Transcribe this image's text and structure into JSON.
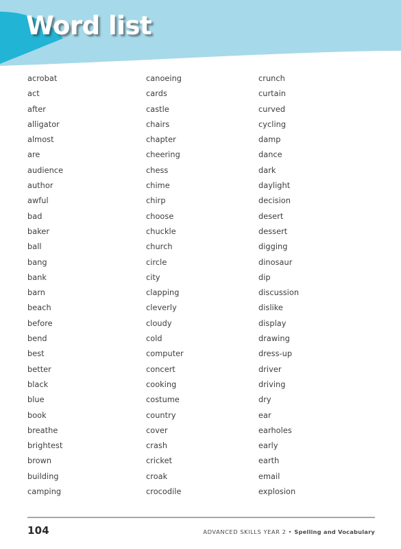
{
  "header": {
    "title": "Word list",
    "band_color": "#a6d9ea",
    "accent_color": "#22b4d4",
    "title_color": "#ffffff"
  },
  "word_list": {
    "columns": [
      {
        "name": "column-1",
        "words": [
          "acrobat",
          "act",
          "after",
          "alligator",
          "almost",
          "are",
          "audience",
          "author",
          "awful",
          "bad",
          "baker",
          "ball",
          "bang",
          "bank",
          "barn",
          "beach",
          "before",
          "bend",
          "best",
          "better",
          "black",
          "blue",
          "book",
          "breathe",
          "brightest",
          "brown",
          "building",
          "camping"
        ]
      },
      {
        "name": "column-2",
        "words": [
          "canoeing",
          "cards",
          "castle",
          "chairs",
          "chapter",
          "cheering",
          "chess",
          "chime",
          "chirp",
          "choose",
          "chuckle",
          "church",
          "circle",
          "city",
          "clapping",
          "cleverly",
          "cloudy",
          "cold",
          "computer",
          "concert",
          "cooking",
          "costume",
          "country",
          "cover",
          "crash",
          "cricket",
          "croak",
          "crocodile"
        ]
      },
      {
        "name": "column-3",
        "words": [
          "crunch",
          "curtain",
          "curved",
          "cycling",
          "damp",
          "dance",
          "dark",
          "daylight",
          "decision",
          "desert",
          "dessert",
          "digging",
          "dinosaur",
          "dip",
          "discussion",
          "dislike",
          "display",
          "drawing",
          "dress-up",
          "driver",
          "driving",
          "dry",
          "ear",
          "earholes",
          "early",
          "earth",
          "email",
          "explosion"
        ]
      }
    ]
  },
  "footer": {
    "page_number": "104",
    "source_series": "ADVANCED SKILLS YEAR 2 • ",
    "source_subject": "Spelling and Vocabulary",
    "rule_color": "#a8a8a8"
  }
}
